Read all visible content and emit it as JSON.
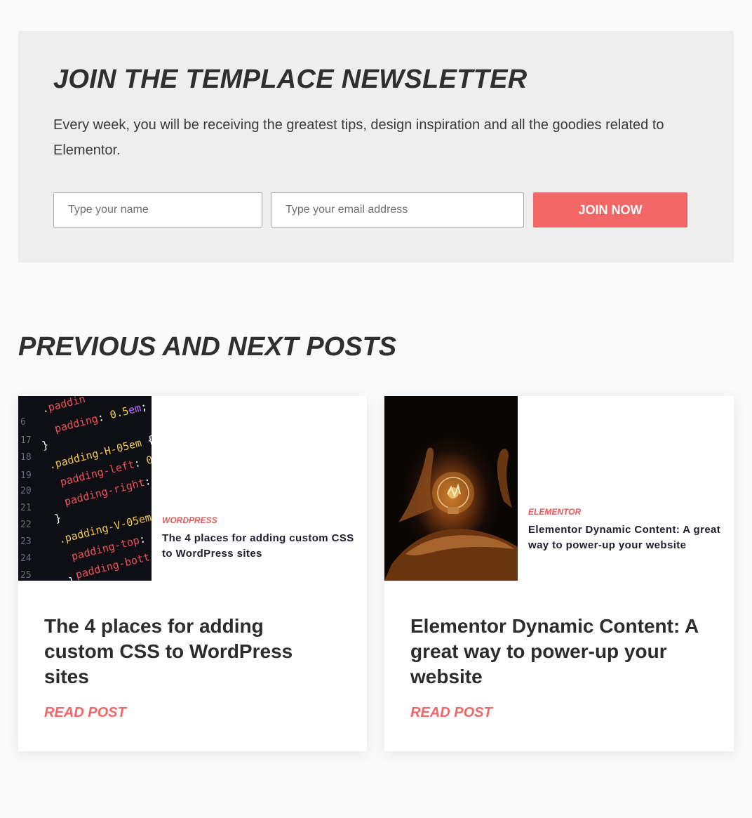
{
  "newsletter": {
    "title": "JOIN THE TEMPLACE NEWSLETTER",
    "description": "Every week, you will be receiving the greatest tips, design inspiration and all the goodies related to Elementor.",
    "name_placeholder": "Type your name",
    "email_placeholder": "Type your email address",
    "button_label": "JOIN NOW"
  },
  "posts_section": {
    "title": "PREVIOUS AND NEXT POSTS"
  },
  "posts": [
    {
      "image_category": "WORDPRESS",
      "image_title": "The 4 places for adding custom CSS to WordPress sites",
      "title": "The 4 places for adding custom CSS to WordPress sites",
      "link_label": "READ POST"
    },
    {
      "image_category": "ELEMENTOR",
      "image_title": "Elementor Dynamic Content: A great way to power-up your website",
      "title": "Elementor Dynamic Content: A great way to power-up your website",
      "link_label": "READ POST"
    }
  ],
  "colors": {
    "accent": "#f26666",
    "newsletter_bg": "#eeeeee",
    "page_bg": "#fafafa"
  }
}
